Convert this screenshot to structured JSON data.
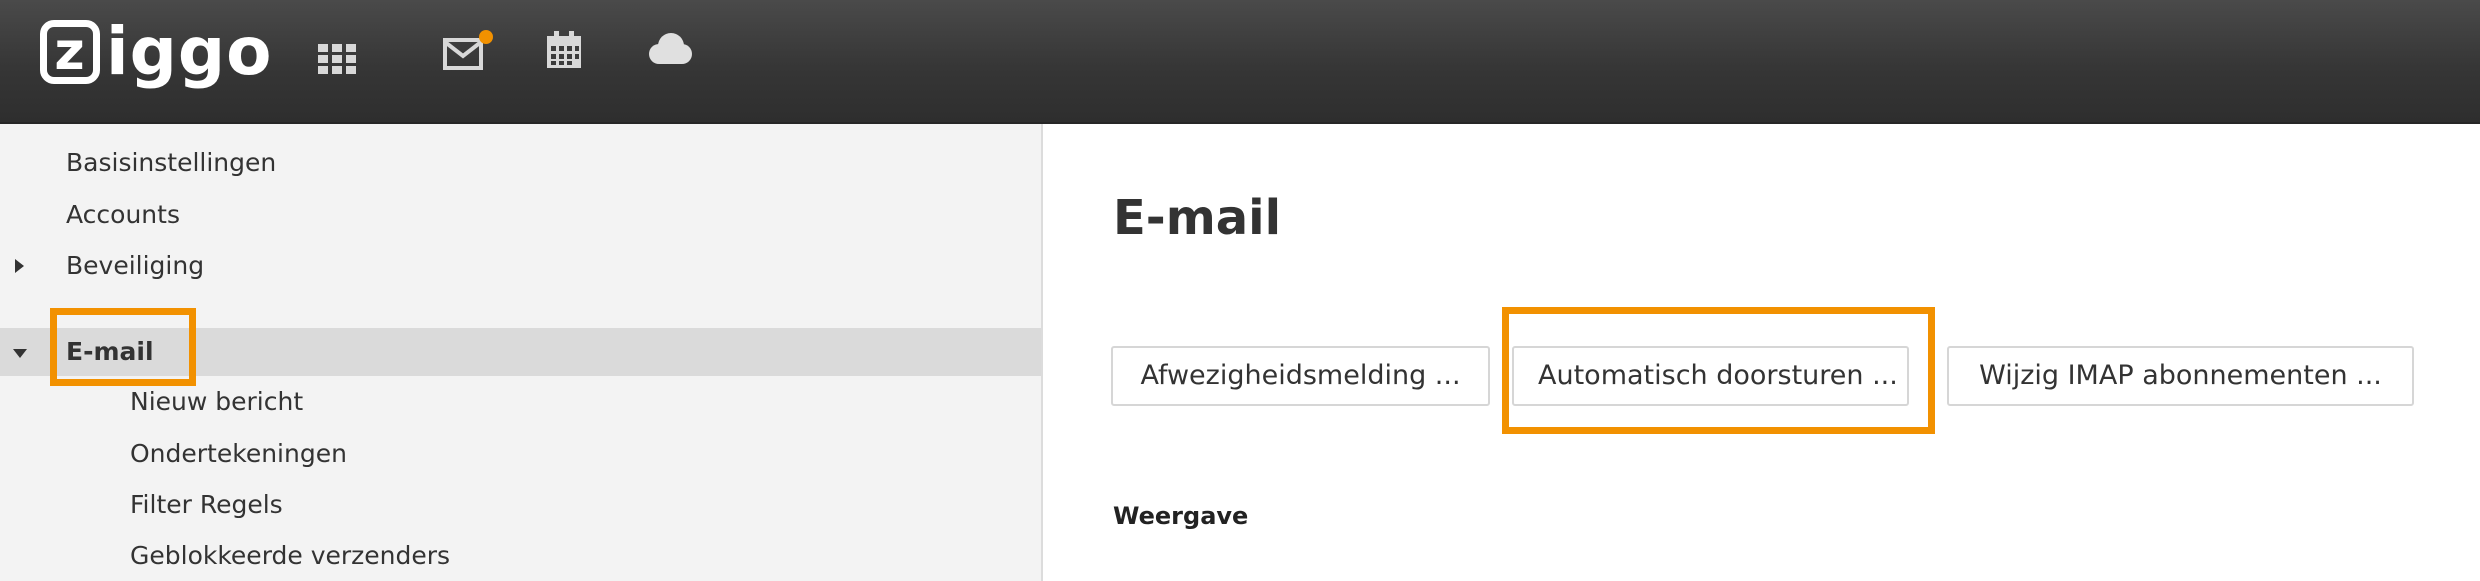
{
  "brand": {
    "logo_text": "iggo",
    "logo_letter": "z",
    "accent": "#f29100"
  },
  "topbar": {
    "icons": [
      "apps-grid-icon",
      "mail-icon",
      "calendar-icon",
      "cloud-icon"
    ],
    "mail_badge_color": "#f29100"
  },
  "sidebar": {
    "items": [
      {
        "label": "Basisinstellingen",
        "level": 0
      },
      {
        "label": "Accounts",
        "level": 0
      },
      {
        "label": "Beveiliging",
        "level": 0,
        "expander": "collapsed"
      },
      {
        "label": "E-mail",
        "level": 0,
        "expander": "expanded",
        "selected": true
      },
      {
        "label": "Nieuw bericht",
        "level": 1
      },
      {
        "label": "Ondertekeningen",
        "level": 1
      },
      {
        "label": "Filter Regels",
        "level": 1
      },
      {
        "label": "Geblokkeerde verzenders",
        "level": 1
      }
    ]
  },
  "main": {
    "title": "E-mail",
    "buttons": [
      {
        "label": "Afwezigheidsmelding ..."
      },
      {
        "label": "Automatisch doorsturen ...",
        "highlighted": true
      },
      {
        "label": "Wijzig IMAP abonnementen ..."
      }
    ],
    "section_label": "Weergave"
  }
}
